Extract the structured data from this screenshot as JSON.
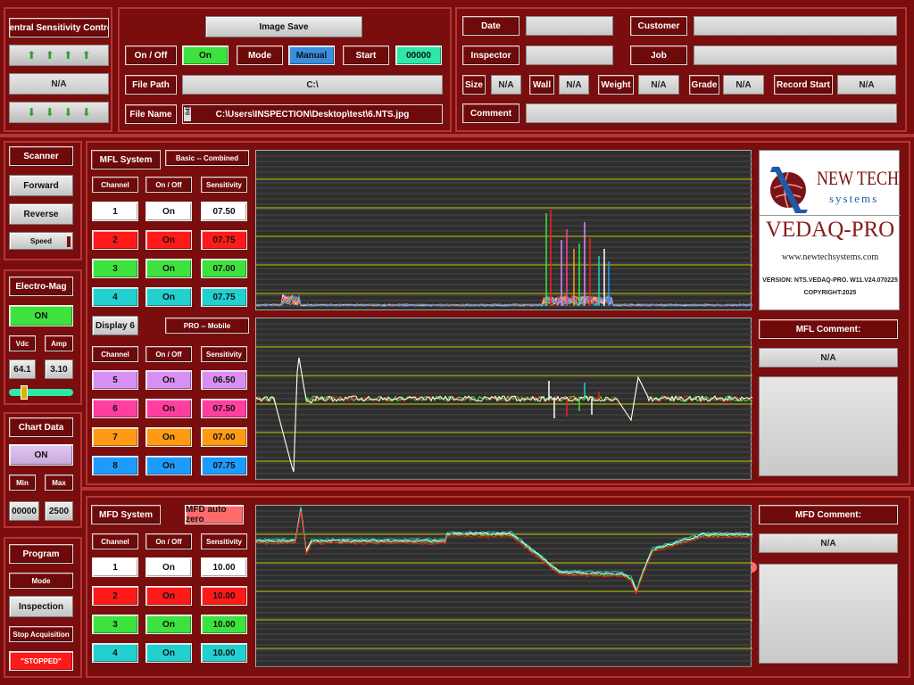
{
  "sensitivity": {
    "title": "Central Sensitivity Control",
    "value": "N/A"
  },
  "image_save": {
    "title": "Image Save",
    "onoff_label": "On / Off",
    "onoff_value": "On",
    "mode_label": "Mode",
    "mode_value": "Manual",
    "start_label": "Start",
    "start_value": "00000",
    "file_path_label": "File Path",
    "file_path_value": "C:\\",
    "file_name_label": "File Name",
    "file_name_value": "C:\\Users\\INSPECTION\\Desktop\\test\\6.NTS.jpg",
    "file_name_prefix": "jpg"
  },
  "info": {
    "date_label": "Date",
    "date_value": "",
    "customer_label": "Customer",
    "customer_value": "",
    "inspector_label": "Inspector",
    "inspector_value": "",
    "job_label": "Job",
    "job_value": "",
    "size_label": "Size",
    "size_value": "N/A",
    "wall_label": "Wall",
    "wall_value": "N/A",
    "weight_label": "Weight",
    "weight_value": "N/A",
    "grade_label": "Grade",
    "grade_value": "N/A",
    "record_start_label": "Record Start",
    "record_start_value": "N/A",
    "comment_label": "Comment",
    "comment_value": ""
  },
  "scanner": {
    "title": "Scanner",
    "forward": "Forward",
    "reverse": "Reverse",
    "speed": "Speed"
  },
  "electro_mag": {
    "title": "Electro-Mag",
    "state": "ON",
    "vdc_label": "Vdc",
    "amp_label": "Amp",
    "vdc_value": "64.1",
    "amp_value": "3.10",
    "slider_level": 0.2
  },
  "chart_data_panel": {
    "title": "Chart Data",
    "state": "ON",
    "min_label": "Min",
    "max_label": "Max",
    "min_value": "00000",
    "max_value": "2500"
  },
  "program": {
    "title": "Program",
    "mode_label": "Mode",
    "mode_value": "Inspection",
    "stop_label": "Stop Acquisition",
    "status": "\"STOPPED\""
  },
  "mfl": {
    "system_label": "MFL System",
    "mode_label": "Basic -- Combined",
    "channel_hdr": "Channel",
    "onoff_hdr": "On / Off",
    "sens_hdr": "Sensitivity",
    "channels": [
      {
        "num": "1",
        "onoff": "On",
        "sens": "07.50",
        "color": "#ffffff"
      },
      {
        "num": "2",
        "onoff": "On",
        "sens": "07.75",
        "color": "#ff1a1a"
      },
      {
        "num": "3",
        "onoff": "On",
        "sens": "07.00",
        "color": "#3ee23e"
      },
      {
        "num": "4",
        "onoff": "On",
        "sens": "07.75",
        "color": "#22d0cf"
      }
    ],
    "display_label": "Display 6",
    "display_mode": "PRO -- Mobile",
    "channels2": [
      {
        "num": "5",
        "onoff": "On",
        "sens": "06.50",
        "color": "#d98ff2"
      },
      {
        "num": "6",
        "onoff": "On",
        "sens": "07.50",
        "color": "#ff3fa0"
      },
      {
        "num": "7",
        "onoff": "On",
        "sens": "07.00",
        "color": "#ff9a14"
      },
      {
        "num": "8",
        "onoff": "On",
        "sens": "07.75",
        "color": "#1e9bff"
      }
    ],
    "comment_title": "MFL Comment:",
    "comment_value": "N/A"
  },
  "mfd": {
    "system_label": "MFD System",
    "auto_zero_label": "MFD auto zero",
    "channel_hdr": "Channel",
    "onoff_hdr": "On / Off",
    "sens_hdr": "Sensitivity",
    "channels": [
      {
        "num": "1",
        "onoff": "On",
        "sens": "10.00",
        "color": "#ffffff"
      },
      {
        "num": "2",
        "onoff": "On",
        "sens": "10.00",
        "color": "#ff1a1a"
      },
      {
        "num": "3",
        "onoff": "On",
        "sens": "10.00",
        "color": "#3ee23e"
      },
      {
        "num": "4",
        "onoff": "On",
        "sens": "10.00",
        "color": "#22d0cf"
      }
    ],
    "comment_title": "MFD Comment:",
    "comment_value": "N/A"
  },
  "logo": {
    "brand_line1": "NEW TECH",
    "brand_line2": "systems",
    "product": "VEDAQ-PRO",
    "url": "www.newtechsystems.com",
    "version": "VERSION: NTS.VEDAQ-PRO. W11.V24.070225",
    "copyright": "COPYRIGHT:2025"
  },
  "colors": {
    "panel_bg": "#7a0d0d",
    "chart_bg": "#2e2e2e",
    "grid_yellow": "#c8c800",
    "on_green": "#3ee23e",
    "start_mint": "#2ee8a8",
    "manual_blue": "#3a8ee0"
  }
}
